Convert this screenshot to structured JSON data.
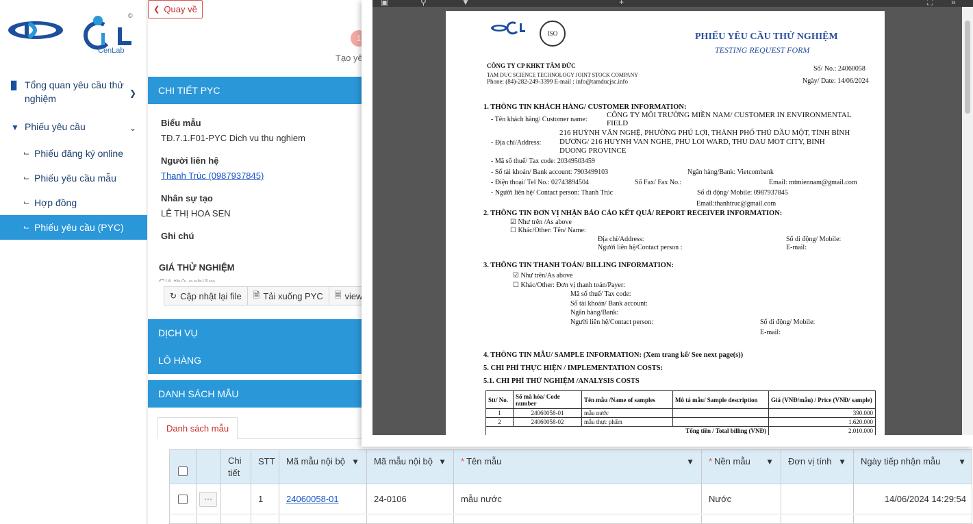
{
  "sidebar": {
    "logo_text": "CenLab",
    "logo_copyright": "©",
    "items": [
      {
        "label": "Tổng quan yêu cầu thử nghiệm",
        "icon": "bar-chart-icon"
      },
      {
        "label": "Phiếu yêu cầu",
        "icon": "filter-icon"
      },
      {
        "label": "Phiếu đăng ký online"
      },
      {
        "label": "Phiếu yêu cầu mẫu"
      },
      {
        "label": "Hợp đồng"
      },
      {
        "label": "Phiếu yêu cầu (PYC)"
      }
    ]
  },
  "header": {
    "back_label": "Quay về",
    "step_number": "1",
    "step_label": "Tạo yê"
  },
  "detail": {
    "section_title": "CHI TIẾT PYC",
    "template_label": "Biểu mẫu",
    "template_value": "TĐ.7.1.F01-PYC Dich vu thu nghiem",
    "contact_label": "Người liên hệ",
    "contact_value": "Thanh Trúc (0987937845)",
    "staff_label": "Nhân sự tạo",
    "staff_value": "LÊ THỊ HOA SEN",
    "note_label": "Ghi chú",
    "price_title": "GIÁ THỬ NGHIỆM",
    "price_sub": "Giá thử nghiệm"
  },
  "actions": {
    "reload_label": "Cập nhật lại file",
    "download_label": "Tải xuống PYC",
    "view_label": "view"
  },
  "sections": {
    "services": "DỊCH VỤ",
    "batch": "LÔ HÀNG",
    "samples": "DANH SÁCH MẪU"
  },
  "tab": {
    "label": "Danh sách mẫu"
  },
  "grid": {
    "columns": [
      "Chi tiết",
      "STT",
      "Mã mẫu nội bộ",
      "Mã mẫu nội bộ",
      "Tên mẫu",
      "Nền mẫu",
      "Đơn vị tính",
      "Ngày tiếp nhận mẫu"
    ],
    "rows": [
      {
        "stt": "1",
        "code": "24060058-01",
        "internal": "24-0106",
        "name": "mẫu nước",
        "matrix": "Nước",
        "unit": "",
        "date": "14/06/2024 14:29:54"
      }
    ],
    "more_label": "···"
  },
  "viewer": {
    "title_vi": "PHIẾU YÊU CẦU THỬ NGHIỆM",
    "title_en": "TESTING REQUEST FORM",
    "company": "CÔNG TY CP KHKT TÂM ĐỨC",
    "company_en": "TAM DUC SCIENCE TECHNOLOGY JOINT STOCK COMPANY",
    "company_contact": "Phone: (84)-282-249-3399  E-mail : info@tamducjsc.info",
    "no_label": "Số/ No.: 24060058",
    "date_label": "Ngày/ Date: 14/06/2024",
    "s1": "1.  THÔNG TIN KHÁCH HÀNG/ CUSTOMER INFORMATION:",
    "cust_label": "- Tên khách hàng/ Customer name:",
    "cust_1": "CÔNG TY MÔI TRƯỜNG MIỀN NAM/ CUSTOMER IN ENVIRONMENTAL",
    "cust_2": "FIELD",
    "addr_label": "- Địa chỉ/Address:",
    "addr_1": "216 HUỲNH VĂN NGHỆ, PHƯỜNG PHÚ LỢI, THÀNH PHỐ THỦ DẦU MỘT, TỈNH BÌNH",
    "addr_2": "DƯƠNG/ 216 HUYNH VAN NGHE, PHU LOI WARD, THU DAU MOT CITY, BINH",
    "addr_3": "DUONG PROVINCE",
    "tax": "- Mã số thuế/ Tax code:  20349503459",
    "account": "- Số tài khoản/ Bank account:        7903499103",
    "bank": "Ngân hàng/Bank:     Vietcombank",
    "phone": "- Điện thoại/ Tel No.:     02743894504",
    "fax": "Số Fax/ Fax No.:",
    "email": "Email:     mtmiennam@gmail.com",
    "person": "- Người liên hệ/ Contact person:      Thanh Trúc",
    "mobile": "Số di động/ Mobile:       0987937845",
    "email2": "Email:thanhtruc@gmail.com",
    "s2": "2.  THÔNG TIN ĐƠN VỊ NHẬN BÁO CÁO KẾT QUẢ/ REPORT RECEIVER INFORMATION:",
    "as_above": "☑ Như trên /As above",
    "other": "☐ Khác/Other: Tên/ Name:",
    "r_addr": "Địa chỉ/Address:",
    "r_person": "Người liên hệ/Contact person :",
    "r_mobile": "Số di động/ Mobile:",
    "r_email": "E-mail:",
    "s3": "3.  THÔNG TIN THANH TOÁN/ BILLING INFORMATION:",
    "b_above": "☑ Như trên/As above",
    "b_other": "☐ Khác/Other: Đơn vị thanh toán/Payer:",
    "b_tax": "Mã số thuế/ Tax code:",
    "b_acc": "Số tài khoản/ Bank account:",
    "b_bank": "Ngân hàng/Bank:",
    "b_person": "Người liên hệ/Contact person:",
    "b_mobile": "Số di động/ Mobile:",
    "b_email": "E-mail:",
    "s4": "4.  THÔNG TIN MẪU/ SAMPLE INFORMATION: (Xem trang kế/ See next page(s))",
    "s5": "5.  CHI PHÍ THỰC HIỆN / IMPLEMENTATION COSTS:",
    "s51": "5.1. CHI PHÍ THỬ NGHIỆM /ANALYSIS COSTS",
    "t_head": [
      "Stt/ No.",
      "Số mã hóa/ Code number",
      "Tên mẫu /Name of samples",
      "Mô tả mẫu/ Sample description",
      "Giá (VNĐ/mẫu) / Price (VNĐ/ sample)"
    ],
    "t_rows": [
      [
        "1",
        "24060058-01",
        "mẫu nước",
        "",
        "390.000"
      ],
      [
        "2",
        "24060058-02",
        "mẫu thực phẩm",
        "",
        "1.620.000"
      ]
    ],
    "t_total_label": "Tổng tiền / Total billing (VNĐ)",
    "t_total": "2.010.000",
    "iso": "ISO"
  }
}
